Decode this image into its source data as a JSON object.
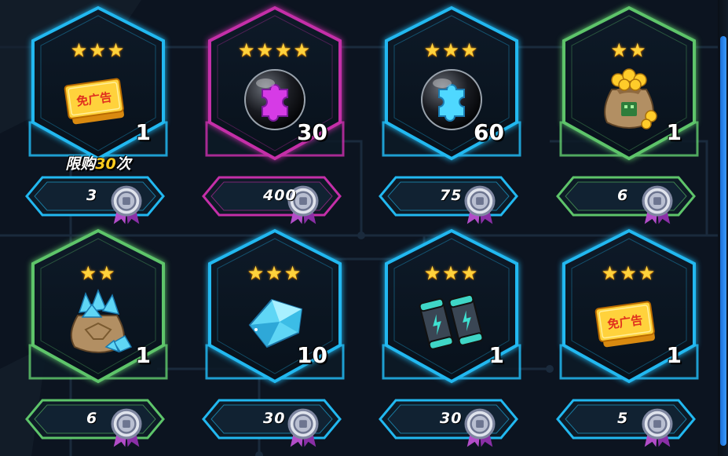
{
  "colors": {
    "accent_blue": "#22b8f0",
    "rarity_purple": "#c42fa8",
    "rarity_green": "#5ec46a",
    "star": "#ffd23c",
    "limit_highlight": "#ffcc1e"
  },
  "price_icon": "silver-medal-icon",
  "shop": {
    "items": [
      {
        "stars": "★★★",
        "rarity": "blue",
        "icon": "ad-free-ticket-icon",
        "ticket_text": "免广告",
        "quantity": "1",
        "limit_prefix": "限购",
        "limit_count": "30",
        "limit_suffix": "次",
        "price": "3"
      },
      {
        "stars": "★★★★",
        "rarity": "purple",
        "icon": "purple-puzzle-orb-icon",
        "quantity": "30",
        "price": "400"
      },
      {
        "stars": "★★★",
        "rarity": "blue",
        "icon": "blue-puzzle-orb-icon",
        "quantity": "60",
        "price": "75"
      },
      {
        "stars": "★★",
        "rarity": "green",
        "icon": "gold-coin-bag-icon",
        "quantity": "1",
        "price": "6"
      },
      {
        "stars": "★★",
        "rarity": "green",
        "icon": "crystal-bag-icon",
        "quantity": "1",
        "price": "6"
      },
      {
        "stars": "★★★",
        "rarity": "blue",
        "icon": "blue-crystal-icon",
        "quantity": "10",
        "price": "30"
      },
      {
        "stars": "★★★",
        "rarity": "blue",
        "icon": "battery-icon",
        "quantity": "1",
        "price": "30"
      },
      {
        "stars": "★★★",
        "rarity": "blue",
        "icon": "ad-free-ticket-icon",
        "ticket_text": "免广告",
        "quantity": "1",
        "price": "5"
      }
    ]
  }
}
